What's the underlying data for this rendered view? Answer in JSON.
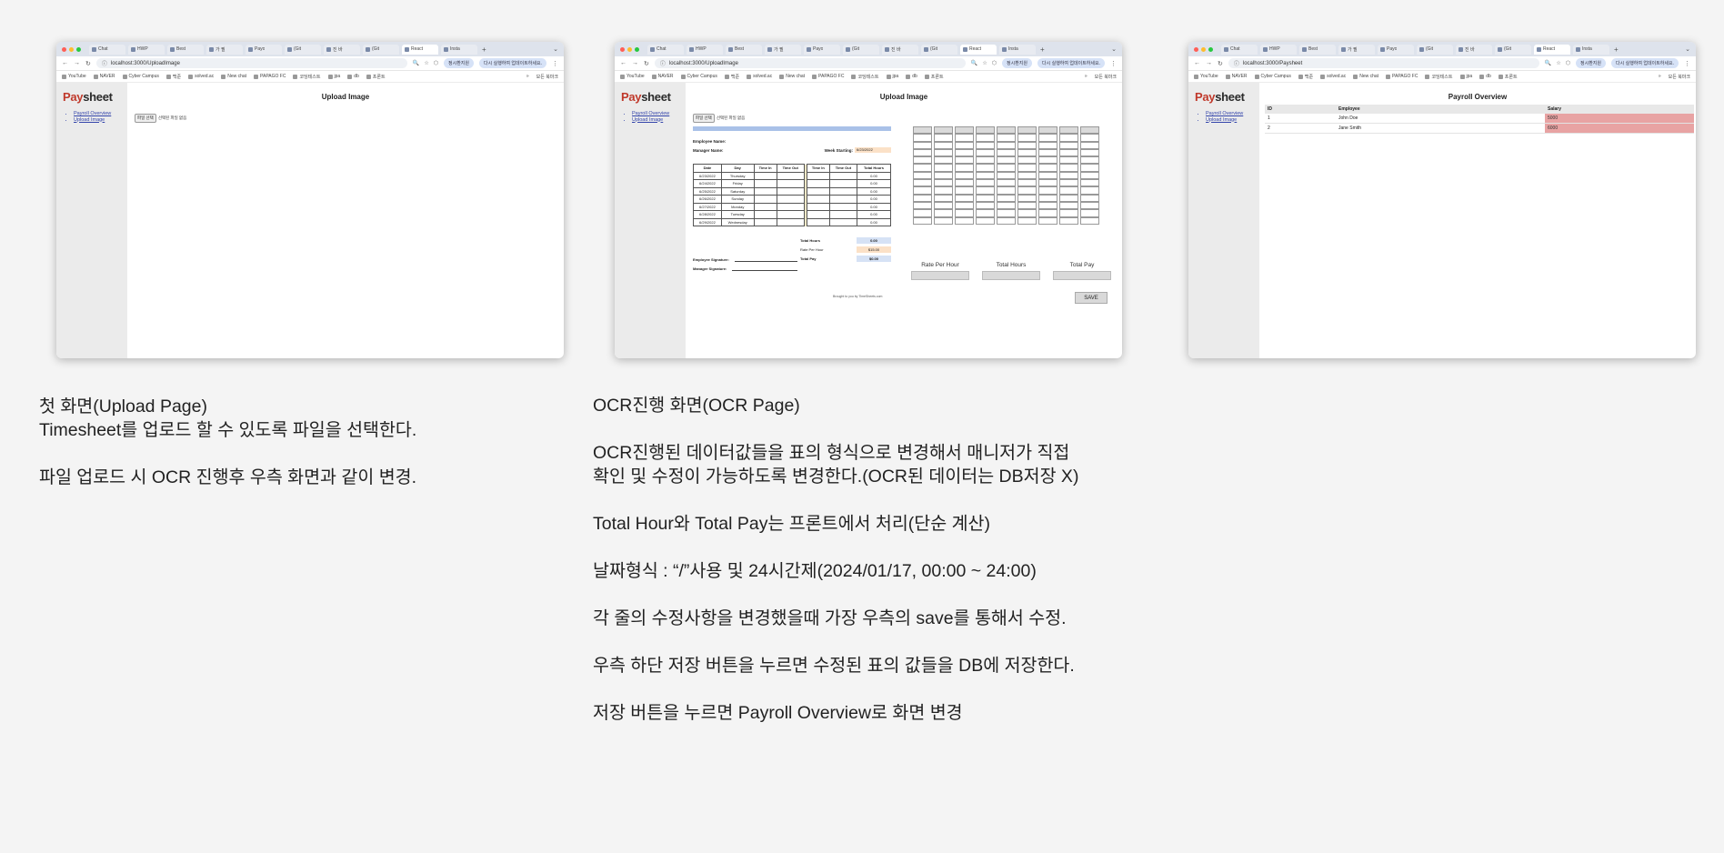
{
  "browser": {
    "tabs": [
      "Chat",
      "HWP",
      "Best",
      "가 필",
      "Payo",
      "(Git",
      "진 바",
      "(Git",
      "React",
      "Insta"
    ],
    "bookmarks": [
      "YouTube",
      "NAVER",
      "Cyber Campus",
      "백준",
      "solved.ac",
      "New chat",
      "PAPAGO FC",
      "코딩테스트",
      "jpa",
      "db",
      "프론트"
    ],
    "bookmarks_more": "»",
    "bookmarks_right": "모든 북마크",
    "profile_label": "정시환지원",
    "restart_label": "다시 실행하여 업데이트하세요."
  },
  "shots": {
    "upload": {
      "url": "localhost:3000/UploadImage",
      "title": "Upload Image",
      "file_button": "파일 선택",
      "file_label": "선택된 파일 없음"
    },
    "ocr": {
      "url": "localhost:3000/UploadImage",
      "title": "Upload Image",
      "file_button": "파일 선택",
      "file_label": "선택된 파일 없음",
      "employee_name_label": "Employee Name:",
      "manager_name_label": "Manager Name:",
      "week_starting_label": "Week Starting:",
      "week_starting_value": "6/23/2022",
      "table_headers": [
        "Date",
        "Day",
        "Time In",
        "Time Out",
        "Time In",
        "Time Out",
        "Total Hours"
      ],
      "rows": [
        {
          "date": "6/23/2022",
          "day": "Thursday",
          "total": "0.00"
        },
        {
          "date": "6/24/2022",
          "day": "Friday",
          "total": "0.00"
        },
        {
          "date": "6/25/2022",
          "day": "Saturday",
          "total": "0.00"
        },
        {
          "date": "6/26/2022",
          "day": "Sunday",
          "total": "0.00"
        },
        {
          "date": "6/27/2022",
          "day": "Monday",
          "total": "0.00"
        },
        {
          "date": "6/28/2022",
          "day": "Tuesday",
          "total": "0.00"
        },
        {
          "date": "6/29/2022",
          "day": "Wednesday",
          "total": "0.00"
        }
      ],
      "total_hours_label": "Total Hours",
      "total_hours_value": "0.00",
      "rate_label": "Rate Per Hour",
      "rate_value": "$15.00",
      "total_pay_label": "Total Pay",
      "total_pay_value": "$0.00",
      "employee_signature_label": "Employee Signature:",
      "manager_signature_label": "Manager Signature:",
      "brought_by": "Brought to you by TimeSheets.com",
      "edit_labels": [
        "Rate Per Hour",
        "Total Hours",
        "Total Pay"
      ],
      "save_label": "SAVE"
    },
    "payroll": {
      "url": "localhost:3000/Paysheet",
      "title": "Payroll Overview",
      "headers": [
        "ID",
        "Employee",
        "Salary"
      ],
      "rows": [
        {
          "id": "1",
          "employee": "John Doe",
          "salary": "5000"
        },
        {
          "id": "2",
          "employee": "Jane Smith",
          "salary": "6000"
        }
      ]
    }
  },
  "sidebar": {
    "logo_pay": "Pay",
    "logo_sheet": "sheet",
    "links": [
      "Payroll Overview",
      "Upload Image"
    ]
  },
  "descriptions": {
    "upload": {
      "title": "첫 화면(Upload Page)",
      "line1": "Timesheet를 업로드 할 수 있도록 파일을 선택한다.",
      "line2": "파일 업로드 시 OCR 진행후 우측 화면과 같이 변경."
    },
    "ocr": {
      "title": "OCR진행 화면(OCR Page)",
      "p1a": "OCR진행된 데이터값들을 표의 형식으로 변경해서 매니저가 직접",
      "p1b": "확인 및 수정이 가능하도록 변경한다.(OCR된 데이터는 DB저장 X)",
      "p2": "Total Hour와 Total Pay는 프론트에서 처리(단순 계산)",
      "p3": "날짜형식 : “/”사용 및 24시간제(2024/01/17, 00:00 ~ 24:00)",
      "p4": "각 줄의 수정사항을 변경했을때 가장 우측의 save를 통해서 수정.",
      "p5": "우측 하단 저장 버튼을 누르면 수정된 표의 값들을 DB에 저장한다.",
      "p6": "저장 버튼을 누르면 Payroll Overview로 화면 변경"
    }
  },
  "colors": {
    "background": "#f4f4f4",
    "logo_accent": "#c0392b",
    "ocr_header_bar": "#a9c1e8",
    "ocr_field": "#fbe1c7",
    "salary_cell": "#e8a3a3",
    "sidebar": "#ebebeb"
  }
}
